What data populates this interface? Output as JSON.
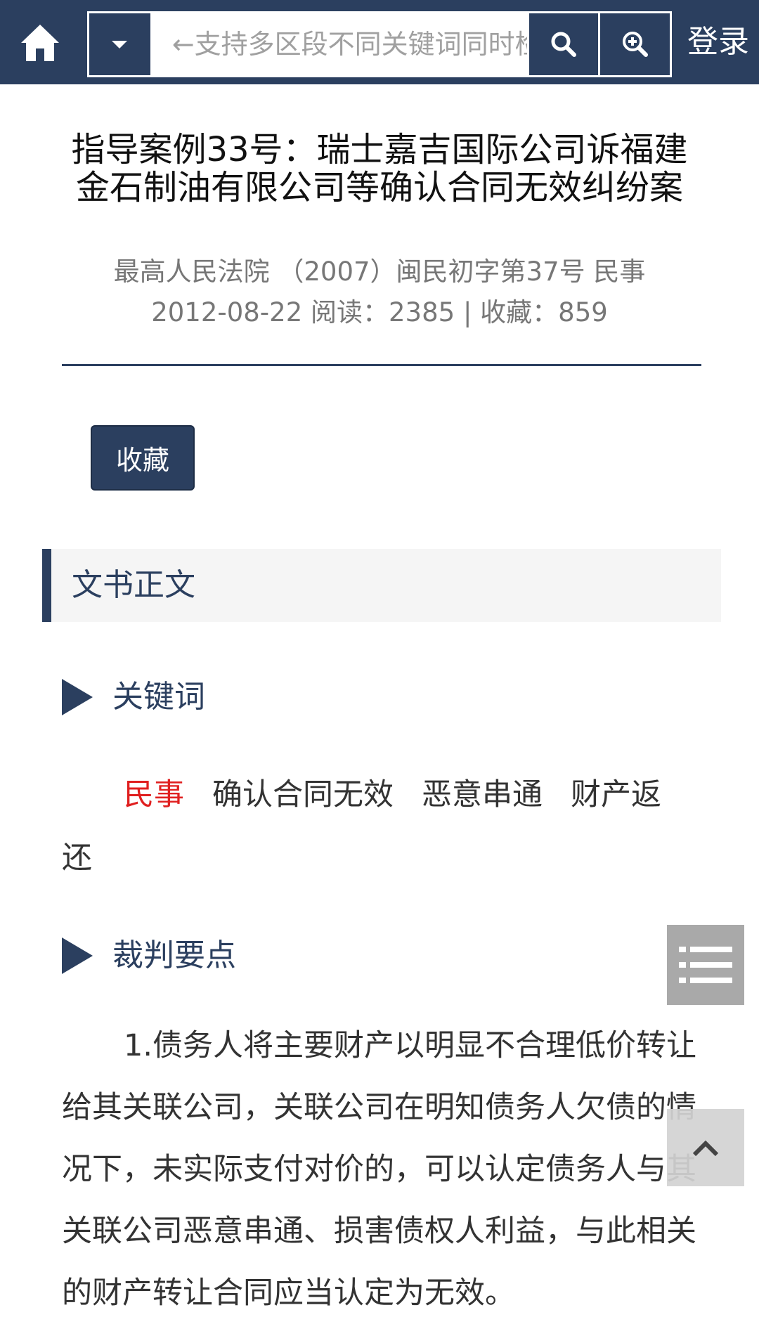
{
  "topbar": {
    "search_placeholder": "←支持多区段不同关键词同时检索",
    "login_label": "登录",
    "icons": [
      "home-icon",
      "caret-down-icon",
      "search-icon",
      "zoom-in-icon"
    ]
  },
  "document": {
    "title": "指导案例33号：瑞士嘉吉国际公司诉福建金石制油有限公司等确认合同无效纠纷案",
    "court": "最高人民法院",
    "case_no": "（2007）闽民初字第37号",
    "category": "民事",
    "date": "2012-08-22",
    "reads_label": "阅读：",
    "reads": "2385",
    "separator": "|",
    "favs_label": "收藏：",
    "favs": "859",
    "favorite_button": "收藏"
  },
  "section": {
    "title": "文书正文",
    "keywords_heading": "关键词",
    "keywords": [
      "民事",
      "确认合同无效",
      "恶意串通",
      "财产返还"
    ],
    "points_heading": "裁判要点",
    "points_text": "1.债务人将主要财产以明显不合理低价转让给其关联公司，关联公司在明知债务人欠债的情况下，未实际支付对价的，可以认定债务人与其关联公司恶意串通、损害债权人利益，与此相关的财产转让合同应当认定为无效。"
  },
  "floating": {
    "menu_icon": "list-menu-icon",
    "top_icon": "chevron-up-icon"
  },
  "colors": {
    "brand": "#2b3f5f",
    "highlight": "#e02020",
    "section_bg": "#f5f5f5"
  }
}
